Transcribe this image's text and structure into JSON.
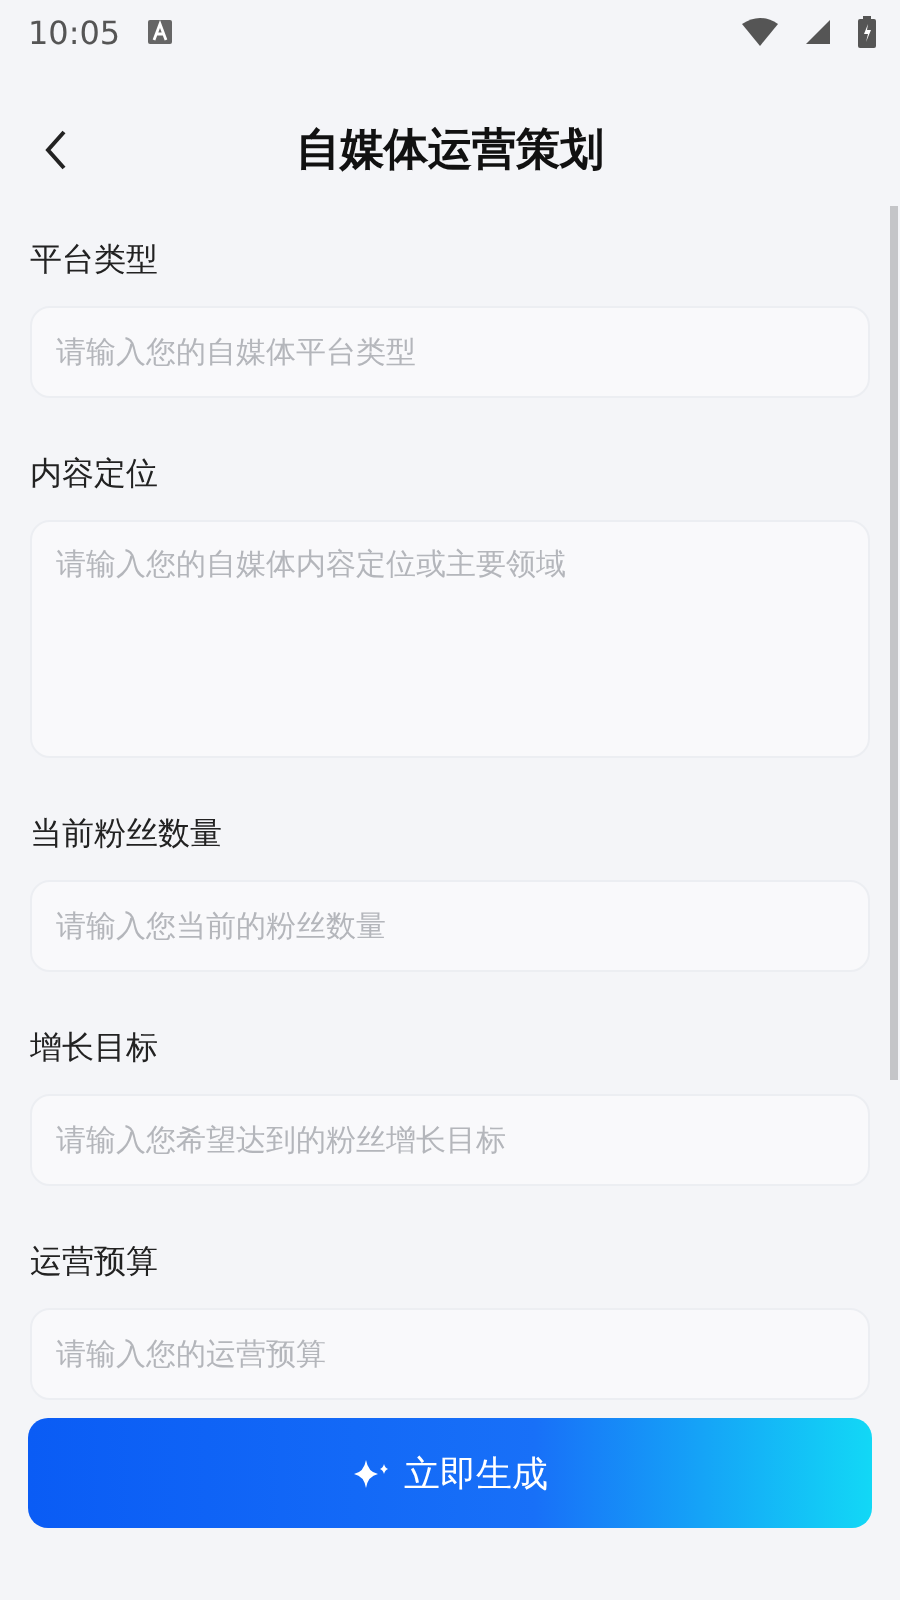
{
  "status_bar": {
    "time": "10:05"
  },
  "header": {
    "title": "自媒体运营策划"
  },
  "fields": [
    {
      "label": "平台类型",
      "kind": "input",
      "placeholder": "请输入您的自媒体平台类型"
    },
    {
      "label": "内容定位",
      "kind": "textarea",
      "placeholder": "请输入您的自媒体内容定位或主要领域"
    },
    {
      "label": "当前粉丝数量",
      "kind": "input",
      "placeholder": "请输入您当前的粉丝数量"
    },
    {
      "label": "增长目标",
      "kind": "input",
      "placeholder": "请输入您希望达到的粉丝增长目标"
    },
    {
      "label": "运营预算",
      "kind": "input",
      "placeholder": "请输入您的运营预算"
    }
  ],
  "submit_button": {
    "label": "立即生成"
  }
}
